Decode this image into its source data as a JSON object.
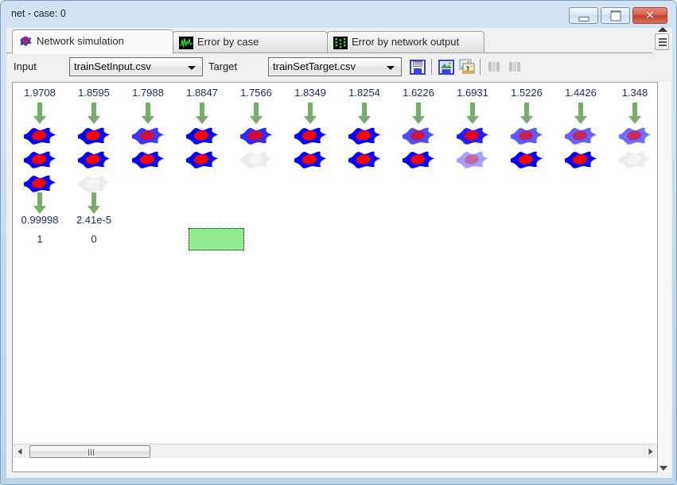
{
  "window": {
    "title": "net - case: 0",
    "buttons": {
      "minimize": "minimize",
      "maximize": "maximize",
      "close": "✕"
    }
  },
  "tabs": [
    {
      "label": "Network simulation",
      "icon": "neuron-icon",
      "selected": true
    },
    {
      "label": "Error by case",
      "icon": "waveform-icon",
      "selected": false
    },
    {
      "label": "Error by network output",
      "icon": "bargraph-icon",
      "selected": false
    }
  ],
  "toolbar": {
    "input_label": "Input",
    "input_value": "trainSetInput.csv",
    "target_label": "Target",
    "target_value": "trainSetTarget.csv",
    "buttons": [
      {
        "name": "save-button",
        "icon": "floppy-disk-icon",
        "enabled": true
      },
      {
        "name": "save-image-button",
        "icon": "floppy-image-icon",
        "enabled": true
      },
      {
        "name": "copy-image-button",
        "icon": "copy-images-icon",
        "enabled": true
      },
      {
        "name": "columns-button-1",
        "icon": "columns-icon",
        "enabled": false
      },
      {
        "name": "columns-button-2",
        "icon": "columns-icon",
        "enabled": false
      }
    ]
  },
  "network": {
    "input_values": [
      "1.9708",
      "1.8595",
      "1.7988",
      "1.8847",
      "1.7566",
      "1.8349",
      "1.8254",
      "1.6226",
      "1.6931",
      "1.5226",
      "1.4426",
      "1.348"
    ],
    "output_values": [
      "0.99998",
      "2.41e-5"
    ],
    "target_values": [
      "1",
      "0"
    ],
    "colors": {
      "neuron_body": "#0000ff",
      "neuron_nucleus": "#ff0000",
      "neuron_inactive": "#ececec",
      "arrow": "#79ab6f",
      "value_text": "#1a2b5c",
      "selection_box": "#90ee90"
    },
    "columns": [
      {
        "neurons": [
          1.0,
          1.0,
          1.0
        ]
      },
      {
        "neurons": [
          1.0,
          1.0,
          0.04
        ]
      },
      {
        "neurons": [
          0.72,
          1.0
        ]
      },
      {
        "neurons": [
          1.0,
          1.0
        ]
      },
      {
        "neurons": [
          0.78,
          0.05
        ]
      },
      {
        "neurons": [
          1.0,
          1.0
        ]
      },
      {
        "neurons": [
          1.0,
          1.0
        ]
      },
      {
        "neurons": [
          0.62,
          1.0
        ]
      },
      {
        "neurons": [
          0.85,
          0.18
        ]
      },
      {
        "neurons": [
          0.55,
          1.0
        ]
      },
      {
        "neurons": [
          0.5,
          1.0
        ]
      },
      {
        "neurons": [
          0.45,
          0.05
        ]
      }
    ]
  },
  "scrollbars": {
    "horizontal_thumb": "horizontal-scroll-thumb",
    "vertical_arrow": "scroll-down-arrow"
  }
}
